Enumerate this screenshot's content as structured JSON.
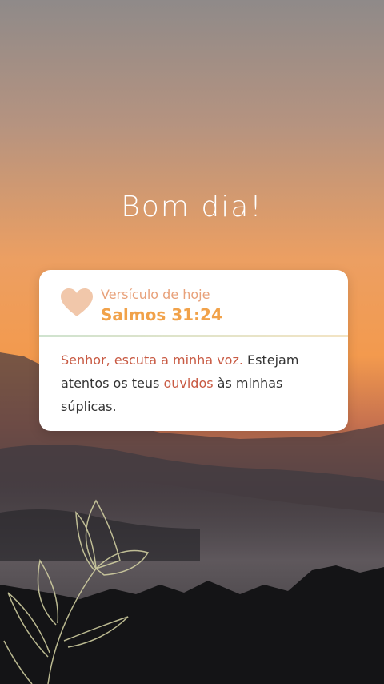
{
  "greeting": "Bom dia!",
  "card": {
    "label": "Versículo de hoje",
    "reference": "Salmos 31:24",
    "verse_parts": [
      {
        "text": "Senhor, escuta a minha voz. ",
        "style": "hl"
      },
      {
        "text": "Estejam atentos os teus ",
        "style": "normal"
      },
      {
        "text": "ouvidos",
        "style": "hl"
      },
      {
        "text": " às minhas súplicas.",
        "style": "normal"
      }
    ]
  },
  "colors": {
    "sky_top": "#9a8c86",
    "sky_mid": "#f3a25a",
    "accent_heading": "#f1a24a",
    "label_color": "#e8a17a",
    "highlight_text": "#c85a43",
    "heart": "#f1c7aa"
  },
  "icons": [
    "heart-icon",
    "flower-illustration"
  ]
}
